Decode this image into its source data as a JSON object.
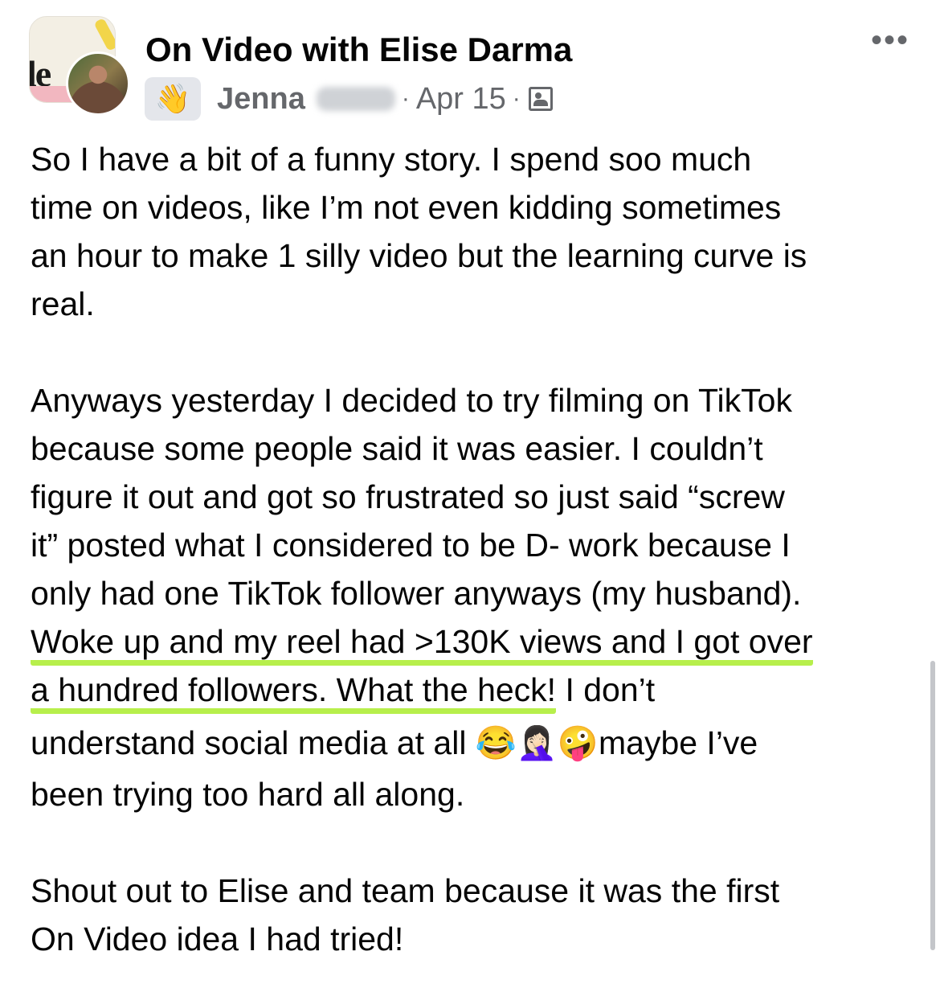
{
  "post": {
    "group_name": "On Video with Elise Darma",
    "group_logo_text": "le",
    "author_first_name": "Jenna",
    "author_badge_icon": "waving-hand-icon",
    "separator": "·",
    "date": "Apr 15",
    "audience_icon": "group-members-icon",
    "more_label": "•••",
    "paragraphs": {
      "p1": [
        "So I have a bit of a funny story. I spend soo much",
        "time on videos, like I’m not even kidding sometimes",
        "an hour to make 1 silly video but the learning curve is",
        "real."
      ],
      "p2": [
        "Anyways yesterday I decided to try filming on TikTok",
        "because some people said it was easier. I couldn’t",
        "figure it out and got so frustrated so just said “screw",
        "it” posted what I considered to be D- work because I",
        "only had one TikTok follower anyways (my husband)."
      ],
      "highlight": [
        "Woke up and my reel had >130K views and I got over",
        "a hundred followers. What the heck!"
      ],
      "after_highlight": " I don’t",
      "emoji_line_text": "understand social media at all ",
      "emojis": "😂🤦🏻‍♀️🤪",
      "emoji_line_end": "maybe I’ve",
      "p2_end": "been trying too hard all along.",
      "p3": [
        "Shout out to Elise and team because it was the first",
        "On Video idea I had tried!"
      ]
    },
    "highlight_color": "#b7ef4c"
  }
}
